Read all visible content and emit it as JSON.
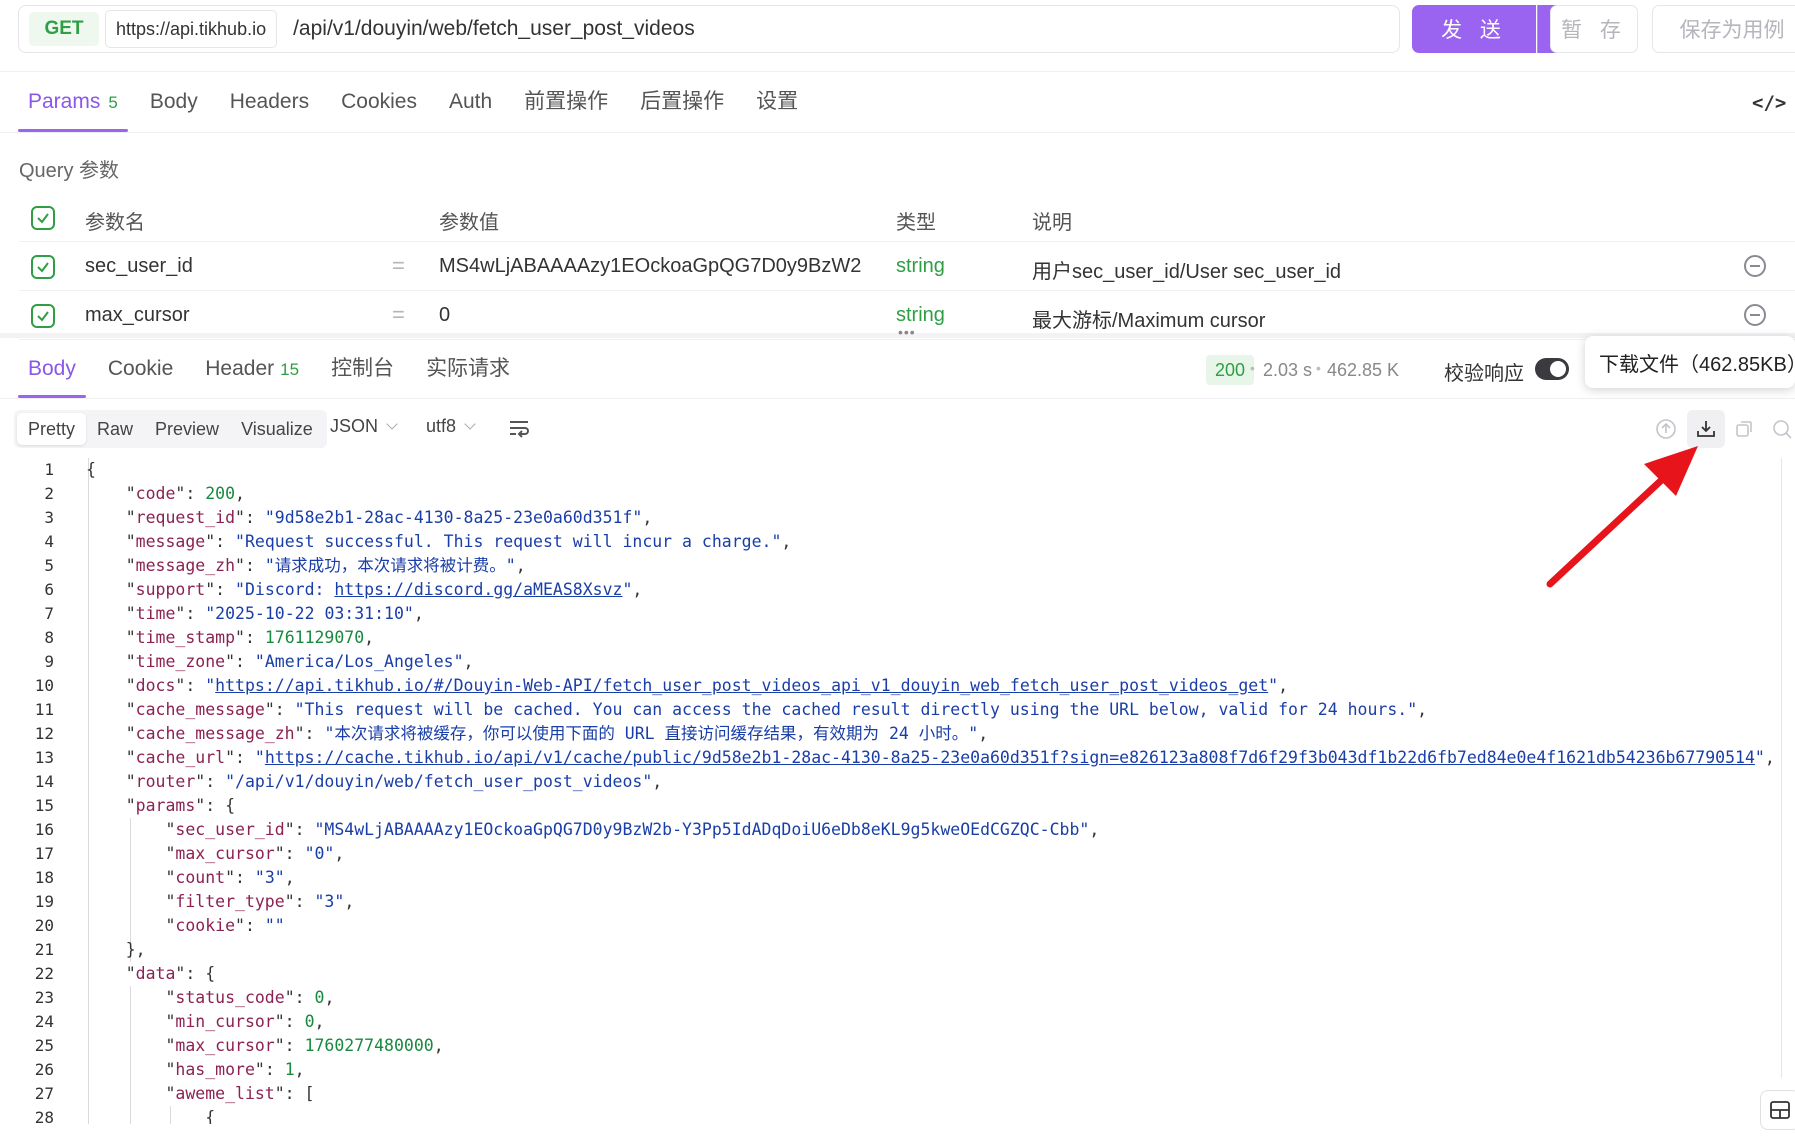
{
  "request": {
    "method": "GET",
    "base_url": "https://api.tikhub.io",
    "path": "/api/v1/douyin/web/fetch_user_post_videos",
    "send_label": "发 送",
    "save_temp_label": "暂 存",
    "save_case_label": "保存为用例"
  },
  "req_tabs": [
    {
      "label": "Params",
      "badge": "5"
    },
    {
      "label": "Body"
    },
    {
      "label": "Headers"
    },
    {
      "label": "Cookies"
    },
    {
      "label": "Auth"
    },
    {
      "label": "前置操作"
    },
    {
      "label": "后置操作"
    },
    {
      "label": "设置"
    }
  ],
  "query_title": "Query 参数",
  "params_table": {
    "headers": {
      "name": "参数名",
      "value": "参数值",
      "type": "类型",
      "desc": "说明"
    },
    "rows": [
      {
        "name": "sec_user_id",
        "eq": "=",
        "value": "MS4wLjABAAAAzy1EOckoaGpQG7D0y9BzW2",
        "type": "string",
        "desc": "用户sec_user_id/User sec_user_id"
      },
      {
        "name": "max_cursor",
        "eq": "=",
        "value": "0",
        "type": "string",
        "desc": "最大游标/Maximum cursor"
      }
    ]
  },
  "res_tabs": [
    {
      "label": "Body"
    },
    {
      "label": "Cookie"
    },
    {
      "label": "Header",
      "badge": "15"
    },
    {
      "label": "控制台"
    },
    {
      "label": "实际请求"
    }
  ],
  "response": {
    "status": "200",
    "time": "2.03 s",
    "size": "462.85 K",
    "verify_label": "校验响应",
    "tooltip": "下载文件（462.85KB）"
  },
  "view_tabs": [
    "Pretty",
    "Raw",
    "Preview",
    "Visualize"
  ],
  "format": "JSON",
  "encoding": "utf8",
  "code_lines": [
    {
      "n": "1",
      "t": "{"
    },
    {
      "n": "2",
      "t": "    \"code\": 200,"
    },
    {
      "n": "3",
      "t": "    \"request_id\": \"9d58e2b1-28ac-4130-8a25-23e0a60d351f\","
    },
    {
      "n": "4",
      "t": "    \"message\": \"Request successful. This request will incur a charge.\","
    },
    {
      "n": "5",
      "t": "    \"message_zh\": \"请求成功，本次请求将被计费。\","
    },
    {
      "n": "6",
      "t": "    \"support\": \"Discord: https://discord.gg/aMEAS8Xsvz\","
    },
    {
      "n": "7",
      "t": "    \"time\": \"2025-10-22 03:31:10\","
    },
    {
      "n": "8",
      "t": "    \"time_stamp\": 1761129070,"
    },
    {
      "n": "9",
      "t": "    \"time_zone\": \"America/Los_Angeles\","
    },
    {
      "n": "10",
      "t": "    \"docs\": \"https://api.tikhub.io/#/Douyin-Web-API/fetch_user_post_videos_api_v1_douyin_web_fetch_user_post_videos_get\","
    },
    {
      "n": "11",
      "t": "    \"cache_message\": \"This request will be cached. You can access the cached result directly using the URL below, valid for 24 hours.\","
    },
    {
      "n": "12",
      "t": "    \"cache_message_zh\": \"本次请求将被缓存，你可以使用下面的 URL 直接访问缓存结果，有效期为 24 小时。\","
    },
    {
      "n": "13",
      "t": "    \"cache_url\": \"https://cache.tikhub.io/api/v1/cache/public/9d58e2b1-28ac-4130-8a25-23e0a60d351f?sign=e826123a808f7d6f29f3b043df1b22d6fb7ed84e0e4f1621db54236b67790514\","
    },
    {
      "n": "14",
      "t": "    \"router\": \"/api/v1/douyin/web/fetch_user_post_videos\","
    },
    {
      "n": "15",
      "t": "    \"params\": {"
    },
    {
      "n": "16",
      "t": "        \"sec_user_id\": \"MS4wLjABAAAAzy1EOckoaGpQG7D0y9BzW2b-Y3Pp5IdADqDoiU6eDb8eKL9g5kweOEdCGZQC-Cbb\","
    },
    {
      "n": "17",
      "t": "        \"max_cursor\": \"0\","
    },
    {
      "n": "18",
      "t": "        \"count\": \"3\","
    },
    {
      "n": "19",
      "t": "        \"filter_type\": \"3\","
    },
    {
      "n": "20",
      "t": "        \"cookie\": \"\""
    },
    {
      "n": "21",
      "t": "    },"
    },
    {
      "n": "22",
      "t": "    \"data\": {"
    },
    {
      "n": "23",
      "t": "        \"status_code\": 0,"
    },
    {
      "n": "24",
      "t": "        \"min_cursor\": 0,"
    },
    {
      "n": "25",
      "t": "        \"max_cursor\": 1760277480000,"
    },
    {
      "n": "26",
      "t": "        \"has_more\": 1,"
    },
    {
      "n": "27",
      "t": "        \"aweme_list\": ["
    },
    {
      "n": "28",
      "t": "            {"
    }
  ],
  "colors": {
    "accent": "#9b64f0",
    "success": "#2f9e44",
    "arrow": "#e8141c"
  },
  "icons": [
    "chevron-down-icon",
    "code-icon",
    "check-icon",
    "remove-circle-icon",
    "toggle-icon",
    "wrap-lines-icon",
    "upload-icon",
    "download-icon",
    "copy-icon",
    "search-icon",
    "layout-icon",
    "arrow-annotation"
  ]
}
